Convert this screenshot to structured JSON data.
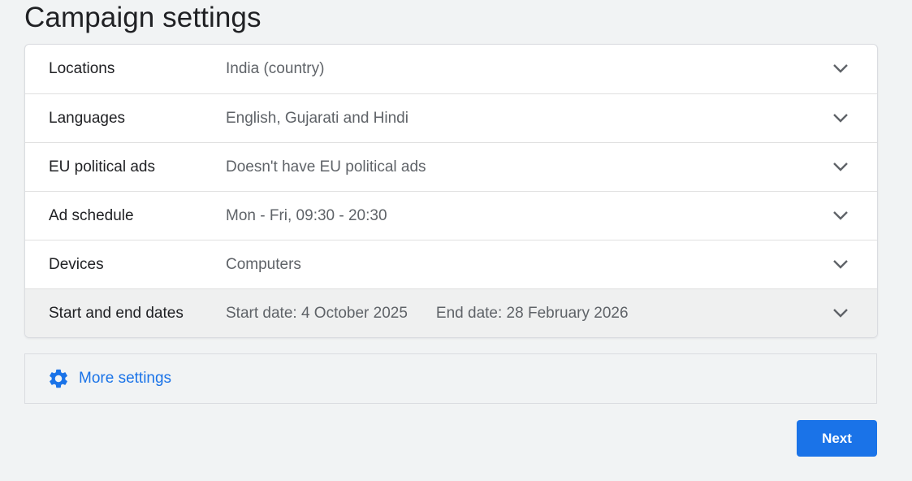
{
  "page": {
    "title": "Campaign settings"
  },
  "settings": [
    {
      "label": "Locations",
      "value": "India (country)"
    },
    {
      "label": "Languages",
      "value": "English, Gujarati and Hindi"
    },
    {
      "label": "EU political ads",
      "value": "Doesn't have EU political ads"
    },
    {
      "label": "Ad schedule",
      "value": "Mon - Fri, 09:30 - 20:30"
    },
    {
      "label": "Devices",
      "value": "Computers"
    },
    {
      "label": "Start and end dates",
      "start": "Start date: 4 October 2025",
      "end": "End date: 28 February 2026"
    }
  ],
  "more_settings": {
    "label": "More settings",
    "icon": "gear-icon"
  },
  "actions": {
    "next_label": "Next"
  },
  "colors": {
    "accent": "#1a73e8",
    "background": "#f1f3f4",
    "selected_row": "#eff0f0"
  }
}
